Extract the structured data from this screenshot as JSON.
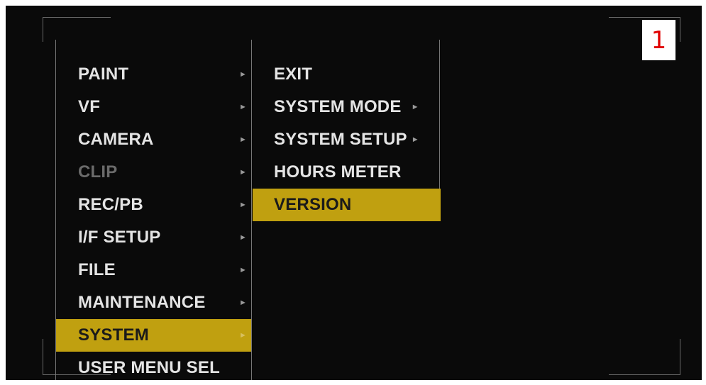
{
  "page_number": "1",
  "main_menu": {
    "items": [
      {
        "label": "PAINT",
        "arrow": "►"
      },
      {
        "label": "VF",
        "arrow": "►"
      },
      {
        "label": "CAMERA",
        "arrow": "►"
      },
      {
        "label": "CLIP",
        "arrow": "►"
      },
      {
        "label": "REC/PB",
        "arrow": "►"
      },
      {
        "label": "I/F SETUP",
        "arrow": "►"
      },
      {
        "label": "FILE",
        "arrow": "►"
      },
      {
        "label": "MAINTENANCE",
        "arrow": "►"
      },
      {
        "label": "SYSTEM",
        "arrow": "►"
      },
      {
        "label": "USER MENU SEL"
      }
    ],
    "disabled": [
      "CLIP"
    ],
    "selected": "SYSTEM"
  },
  "sub_menu": {
    "items": [
      {
        "label": "EXIT"
      },
      {
        "label": "SYSTEM MODE",
        "arrow": "►"
      },
      {
        "label": "SYSTEM SETUP",
        "arrow": "►"
      },
      {
        "label": "HOURS METER"
      },
      {
        "label": "VERSION"
      }
    ],
    "selected": "VERSION"
  },
  "colors": {
    "highlight": "#c0a010",
    "background": "#0a0a0a",
    "text": "#e4e4e4",
    "disabled_text": "#6b6b6b",
    "badge_text": "#e00000"
  }
}
